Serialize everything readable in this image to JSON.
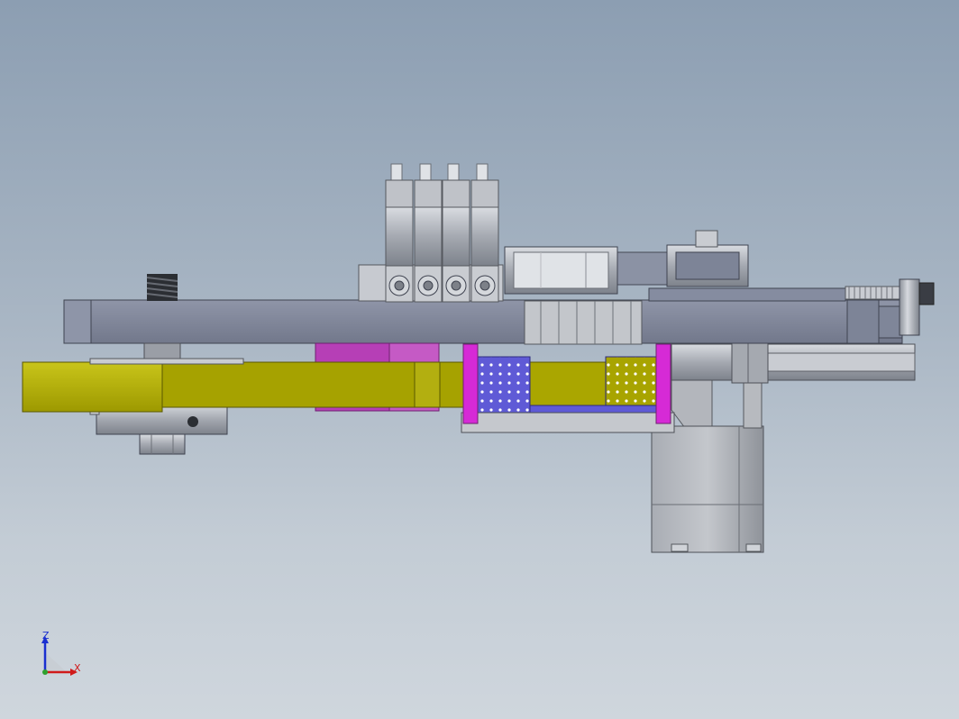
{
  "viewport": {
    "background_top": "#8c9eb2",
    "background_bottom": "#cfd6dd"
  },
  "model": {
    "parts": [
      "upper-frame-plate",
      "valve-manifold",
      "timing-belt-pulley",
      "idler-pulley",
      "adjustment-screw",
      "compression-spring",
      "yellow-arm",
      "blue-vacuum-pad-left",
      "blue-vacuum-pad-right",
      "magenta-spacer-block",
      "magenta-standoffs",
      "linear-guide-rail",
      "stepper-motor",
      "bearing-housing",
      "hex-nut"
    ],
    "colors": {
      "frame": "#7e8597",
      "yellow_arm": "#b7b300",
      "magenta": "#d62ad6",
      "blue_pad": "#5f5ad6",
      "metal": "#9a9ea6"
    }
  },
  "triad": {
    "z_label": "Z",
    "x_label": "X",
    "z_color": "#1a2fd0",
    "x_color": "#d01a1a"
  }
}
